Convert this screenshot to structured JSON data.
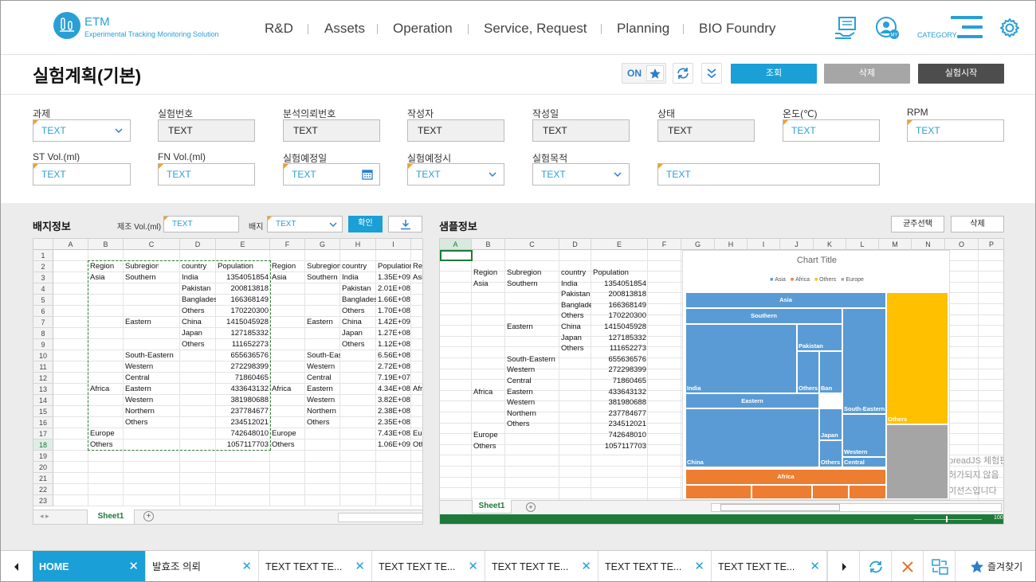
{
  "header": {
    "logo_name": "ETM",
    "logo_sub": "Experimental Tracking Monitoring Solution",
    "nav": [
      "R&D",
      "Assets",
      "Operation",
      "Service, Request",
      "Planning",
      "BIO Foundry"
    ],
    "category": "CATEGORY"
  },
  "page": {
    "title": "실험계획(기본)",
    "toggle": "ON",
    "btn_search": "조회",
    "btn_delete": "삭제",
    "btn_start": "실험시작"
  },
  "form": {
    "row1": [
      {
        "label": "과제",
        "value": "TEXT"
      },
      {
        "label": "실험번호",
        "value": "TEXT"
      },
      {
        "label": "분석의뢰번호",
        "value": "TEXT"
      },
      {
        "label": "작성자",
        "value": "TEXT"
      },
      {
        "label": "작성일",
        "value": "TEXT"
      },
      {
        "label": "상태",
        "value": "TEXT"
      },
      {
        "label": "온도(℃)",
        "value": "TEXT"
      },
      {
        "label": "RPM",
        "value": "TEXT"
      }
    ],
    "row2": [
      {
        "label": "ST Vol.(ml)",
        "value": "TEXT"
      },
      {
        "label": "FN Vol.(ml)",
        "value": "TEXT"
      },
      {
        "label": "실험예정일",
        "value": "TEXT"
      },
      {
        "label": "실험예정시",
        "value": "TEXT"
      },
      {
        "label": "실험목적",
        "value": "TEXT"
      },
      {
        "label": "",
        "value": "TEXT"
      }
    ]
  },
  "left": {
    "title": "배지정보",
    "vol_label": "제조 Vol.(ml)",
    "vol_value": "TEXT",
    "media_label": "배지",
    "media_value": "TEXT",
    "confirm": "확인",
    "sheet_tab": "Sheet1"
  },
  "right": {
    "title": "샘플정보",
    "btn_select": "균주선택",
    "btn_delete": "삭제",
    "sheet_tab": "Sheet1",
    "watermark": [
      "preadJS 체험판",
      "허가되지 않음",
      "이선스입니다"
    ],
    "zoom": "100"
  },
  "sheet": {
    "header": [
      "Region",
      "Subregion",
      "country",
      "Population"
    ],
    "rows": [
      [
        "Asia",
        "Southern",
        "India",
        "1354051854",
        "1.35E+09"
      ],
      [
        "",
        "",
        "Pakistan",
        "200813818",
        "2.01E+08"
      ],
      [
        "",
        "",
        "Banglades",
        "166368149",
        "1.66E+08"
      ],
      [
        "",
        "",
        "Others",
        "170220300",
        "1.70E+08"
      ],
      [
        "",
        "Eastern",
        "China",
        "1415045928",
        "1.42E+09"
      ],
      [
        "",
        "",
        "Japan",
        "127185332",
        "1.27E+08"
      ],
      [
        "",
        "",
        "Others",
        "111652273",
        "1.12E+08"
      ],
      [
        "",
        "South-Eastern",
        "",
        "655636576",
        "6.56E+08"
      ],
      [
        "",
        "Western",
        "",
        "272298399",
        "2.72E+08"
      ],
      [
        "",
        "Central",
        "",
        "71860465",
        "7.19E+07"
      ],
      [
        "Africa",
        "Eastern",
        "",
        "433643132",
        "4.34E+08"
      ],
      [
        "",
        "Western",
        "",
        "381980688",
        "3.82E+08"
      ],
      [
        "",
        "Northern",
        "",
        "237784677",
        "2.38E+08"
      ],
      [
        "",
        "Others",
        "",
        "234512021",
        "2.35E+08"
      ],
      [
        "Europe",
        "",
        "",
        "742648010",
        "7.43E+08"
      ],
      [
        "Others",
        "",
        "",
        "1057117703",
        "1.06E+09"
      ]
    ]
  },
  "left_cols": [
    "A",
    "B",
    "C",
    "D",
    "E",
    "F",
    "G",
    "H",
    "I"
  ],
  "right_cols": [
    "A",
    "B",
    "C",
    "D",
    "E",
    "F",
    "G",
    "H",
    "I",
    "J",
    "K",
    "L",
    "M",
    "N",
    "O",
    "P"
  ],
  "chart_data": {
    "type": "treemap",
    "title": "Chart Title",
    "legend": [
      "Asia",
      "Africa",
      "Others",
      "Europe"
    ],
    "colors": {
      "Asia": "#5b9bd5",
      "Africa": "#ed7d31",
      "Others": "#ffc000",
      "Europe": "#a5a5a5"
    },
    "labels": [
      "Asia",
      "Southern",
      "India",
      "Pakistan",
      "Others",
      "Ban",
      "Eastern",
      "China",
      "Japan",
      "Others",
      "South-Eastern",
      "Western",
      "Central",
      "Others",
      "Africa"
    ]
  },
  "tabs": [
    {
      "label": "HOME"
    },
    {
      "label": "발효조 의뢰"
    },
    {
      "label": "TEXT TEXT TE..."
    },
    {
      "label": "TEXT TEXT TE..."
    },
    {
      "label": "TEXT TEXT TE..."
    },
    {
      "label": "TEXT TEXT TE..."
    },
    {
      "label": "TEXT TEXT TE..."
    }
  ],
  "favorites": "즐겨찾기"
}
